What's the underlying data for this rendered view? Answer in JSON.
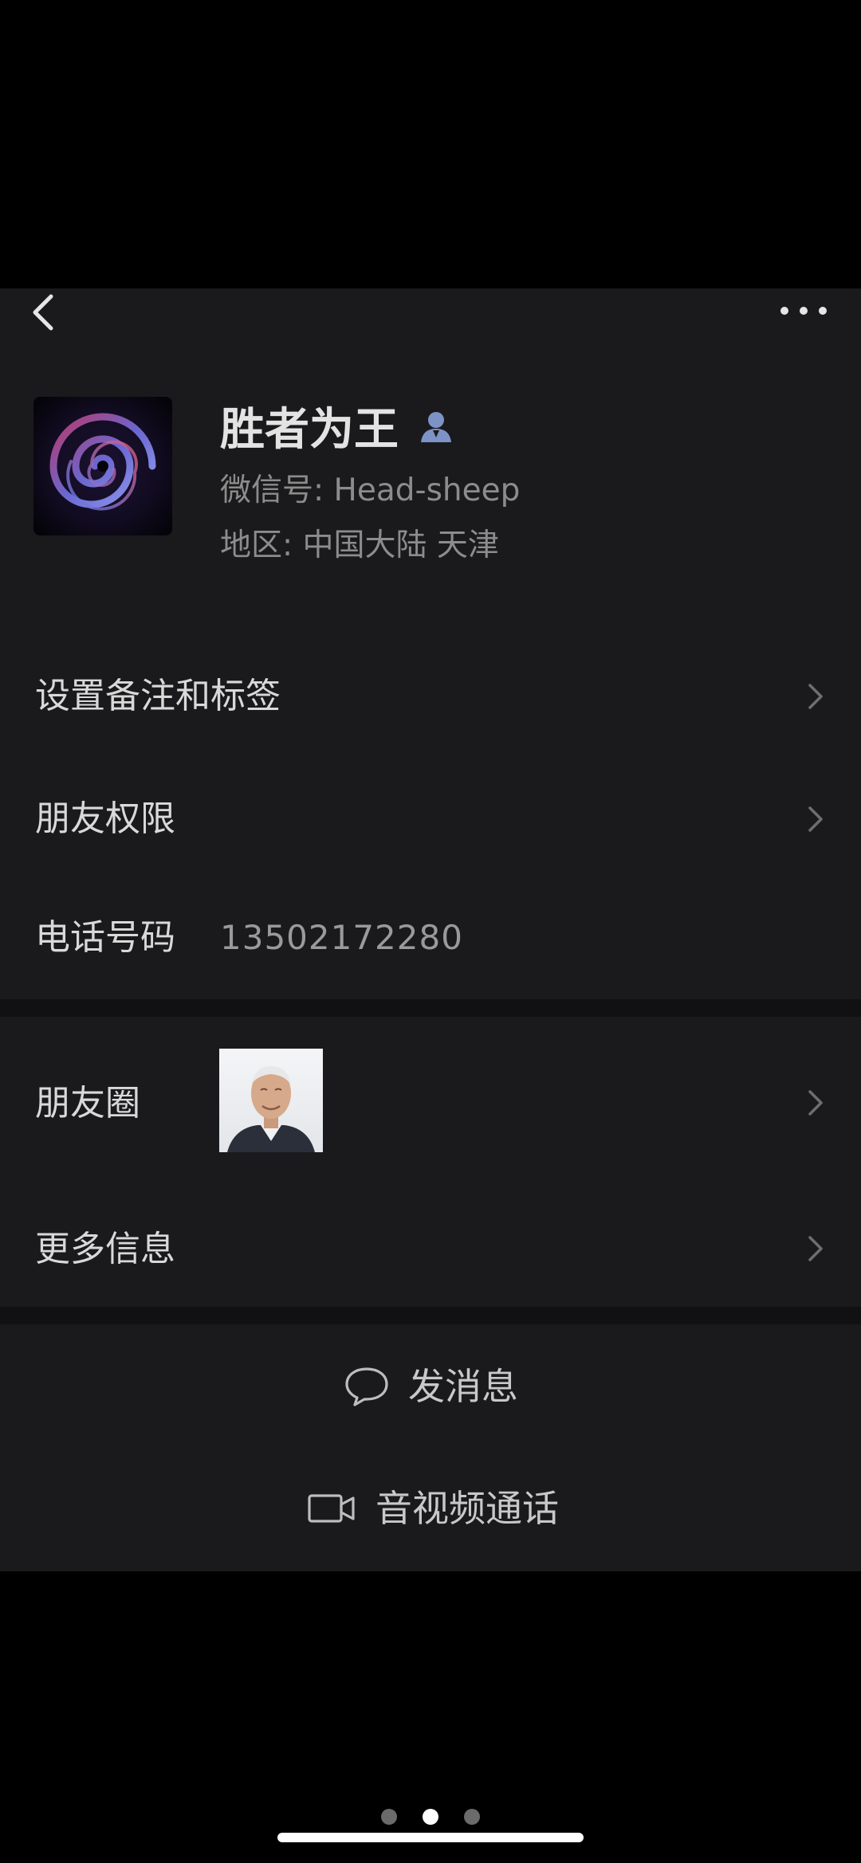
{
  "profile": {
    "nickname": "胜者为王",
    "wechat_id": "微信号: Head-sheep",
    "region": "地区: 中国大陆  天津"
  },
  "rows": {
    "remark_tags": "设置备注和标签",
    "friend_permissions": "朋友权限",
    "phone_label": "电话号码",
    "phone_value": "13502172280",
    "moments": "朋友圈",
    "more_info": "更多信息"
  },
  "actions": {
    "send_message": "发消息",
    "av_call": "音视频通话"
  },
  "icons": {
    "back": "chevron-left-icon",
    "more": "more-dots-icon",
    "contact": "contact-person-icon",
    "row": "chevron-right-icon",
    "message": "chat-bubble-icon",
    "video": "video-camera-icon"
  },
  "colors": {
    "panel_bg": "#1a1a1c",
    "separator_bg": "#111113",
    "contact_icon": "#7d93c8",
    "text": "#d9d9d9",
    "secondary_text": "#8c8c8c"
  },
  "pager": {
    "total": 3,
    "active_index": 1
  }
}
